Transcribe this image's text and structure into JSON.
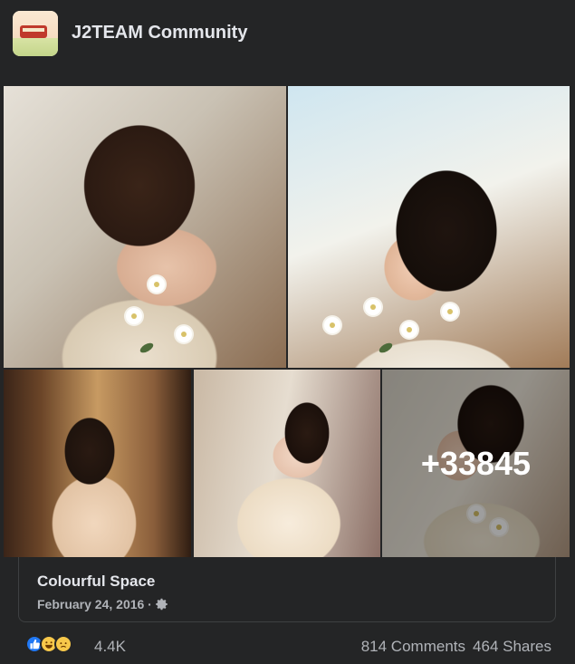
{
  "header": {
    "group_name": "J2TEAM Community",
    "avatar_icon": "group-avatar-icon"
  },
  "photos": {
    "more_count": "+33845"
  },
  "link": {
    "title": "Colourful Space",
    "date": "February 24, 2016 ·",
    "privacy_icon": "gear-icon"
  },
  "footer": {
    "reaction_icons": [
      "like-icon",
      "haha-icon",
      "sad-icon"
    ],
    "reaction_count": "4.4K",
    "comments": "814 Comments",
    "shares": "464 Shares"
  },
  "colors": {
    "background": "#242526",
    "text_primary": "#e4e6eb",
    "text_secondary": "#b0b3b8",
    "like_blue": "#2078f4",
    "emoji_yellow": "#f7c84a"
  }
}
